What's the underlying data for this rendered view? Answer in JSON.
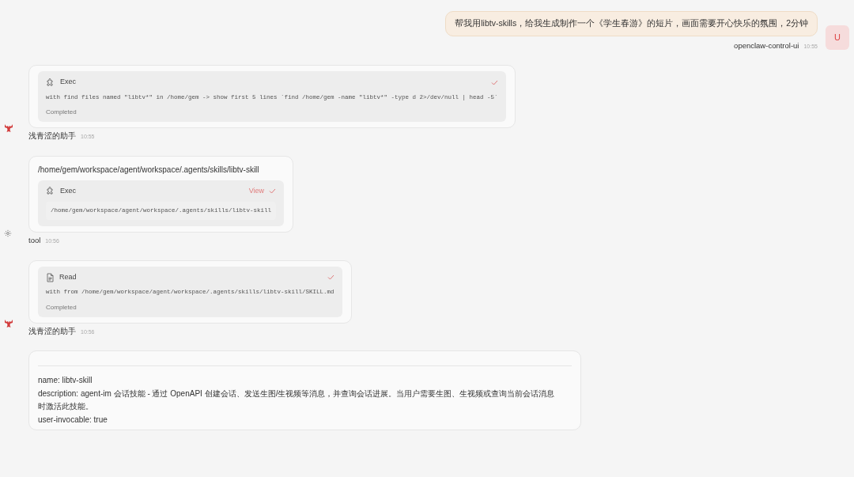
{
  "messages": [
    {
      "kind": "user",
      "text": "帮我用libtv-skills，给我生成制作一个《学生春游》的短片，画面需要开心快乐的氛围，2分钟",
      "avatar": "U",
      "sender": "openclaw-control-ui",
      "time": "10:55"
    },
    {
      "kind": "assistant",
      "sender": "浅青涩的助手",
      "time": "10:55",
      "tools": [
        {
          "kind": "exec",
          "title": "Exec",
          "detail": "with find files named \"libtv*\" in /home/gem -> show first 5 lines `find /home/gem -name \"libtv*\" -type d 2>/dev/null | head -5`",
          "status": "Completed"
        }
      ]
    },
    {
      "kind": "toolresult",
      "sender": "tool",
      "time": "10:56",
      "text": "/home/gem/workspace/agent/workspace/.agents/skills/libtv-skill",
      "tools": [
        {
          "kind": "exec",
          "title": "Exec",
          "view": "View",
          "output": "/home/gem/workspace/agent/workspace/.agents/skills/libtv-skill"
        }
      ]
    },
    {
      "kind": "assistant",
      "sender": "浅青涩的助手",
      "time": "10:56",
      "tools": [
        {
          "kind": "read",
          "title": "Read",
          "detail": "with from /home/gem/workspace/agent/workspace/.agents/skills/libtv-skill/SKILL.md",
          "status": "Completed"
        }
      ]
    },
    {
      "kind": "document",
      "lines": [
        "name: libtv-skill",
        "description: agent-im 会话技能 - 通过 OpenAPI 创建会话、发送生图/生视频等消息，并查询会话进展。当用户需要生图、生视频或查询当前会话消息时激活此技能。",
        "user-invocable: true"
      ]
    }
  ]
}
